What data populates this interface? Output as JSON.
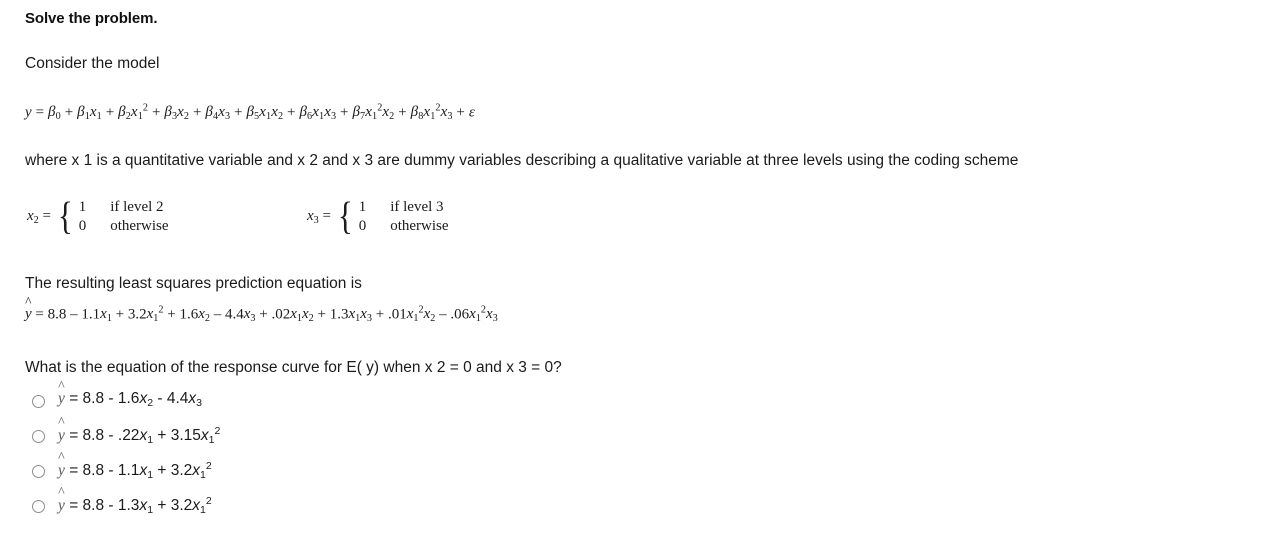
{
  "problem": {
    "heading": "Solve the problem.",
    "intro": "Consider the model",
    "model_equation_plain": "y = β0 + β1x1 + β2x1² + β3x2 + β4x3 + β5x1x2 + β6x1x3 + β7x1²x2 + β8x1²x3 + ε",
    "where_text": "where  x 1 is a quantitative variable and  x 2 and  x 3 are dummy variables describing a qualitative variable at three levels using the coding scheme",
    "coding_scheme": [
      {
        "variable": "x2",
        "equals": "=",
        "cases": [
          {
            "value": "1",
            "condition": "if level 2"
          },
          {
            "value": "0",
            "condition": "otherwise"
          }
        ]
      },
      {
        "variable": "x3",
        "equals": "=",
        "cases": [
          {
            "value": "1",
            "condition": "if level 3"
          },
          {
            "value": "0",
            "condition": "otherwise"
          }
        ]
      }
    ],
    "lsq_intro": "The resulting least squares prediction equation is",
    "prediction_equation_plain": "ŷ = 8.8 – 1.1x1 + 3.2x1² + 1.6x2 – 4.4x3 + .02x1x2 + 1.3x1x3 + .01x1²x2 – .06x1²x3",
    "question": "What is the equation of the response curve for  E( y) when  x 2 = 0 and  x 3 = 0?",
    "options": [
      {
        "id": "option-a",
        "text_plain": "ŷ = 8.8 - 1.6x2 - 4.4x3",
        "selected": false
      },
      {
        "id": "option-b",
        "text_plain": "ŷ = 8.8 - .22x1 + 3.15x1²",
        "selected": false
      },
      {
        "id": "option-c",
        "text_plain": "ŷ = 8.8 - 1.1x1 + 3.2x1²",
        "selected": false
      },
      {
        "id": "option-d",
        "text_plain": "ŷ = 8.8 - 1.3x1 + 3.2x1²",
        "selected": false
      }
    ]
  },
  "colors": {
    "background": "#ffffff",
    "text": "#1b1b1b",
    "heading": "#101010",
    "radio_border": "#8d8d8d"
  }
}
